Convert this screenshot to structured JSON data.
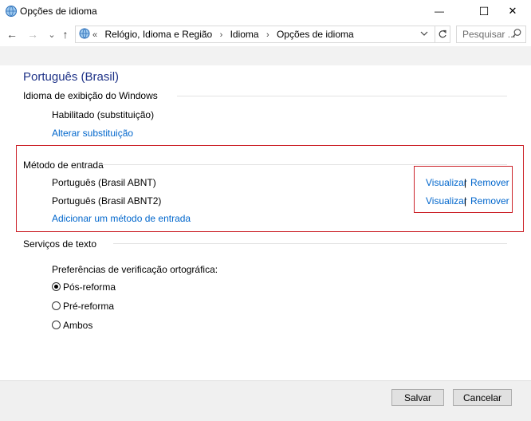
{
  "window": {
    "title": "Opções de idioma",
    "minimize_glyph": "—",
    "maximize_glyph": "☐",
    "close_glyph": "✕"
  },
  "nav": {
    "back_glyph": "←",
    "forward_glyph": "→",
    "recent_glyph": "⌄",
    "up_glyph": "↑",
    "crumb_prefix": "«",
    "breadcrumbs": [
      "Relógio, Idioma e Região",
      "Idioma",
      "Opções de idioma"
    ],
    "crumb_separator": "›",
    "search_placeholder": "Pesquisar ..."
  },
  "page": {
    "language": "Português (Brasil)",
    "display_section": {
      "title": "Idioma de exibição do Windows",
      "status": "Habilitado (substituição)",
      "change_link": "Alterar substituição"
    },
    "input_section": {
      "title": "Método de entrada",
      "methods": [
        {
          "name": "Português (Brasil ABNT)",
          "view": "Visualizar",
          "remove": "Remover"
        },
        {
          "name": "Português (Brasil ABNT2)",
          "view": "Visualizar",
          "remove": "Remover"
        }
      ],
      "separator": "|",
      "add_link": "Adicionar um método de entrada"
    },
    "text_section": {
      "title": "Serviços de texto",
      "spell_label": "Preferências de verificação ortográfica:",
      "options": [
        {
          "label": "Pós-reforma",
          "selected": true
        },
        {
          "label": "Pré-reforma",
          "selected": false
        },
        {
          "label": "Ambos",
          "selected": false
        }
      ]
    }
  },
  "footer": {
    "save": "Salvar",
    "cancel": "Cancelar"
  },
  "colors": {
    "heading": "#1e3287",
    "link": "#0066cc",
    "highlight_box": "#cc2229"
  }
}
